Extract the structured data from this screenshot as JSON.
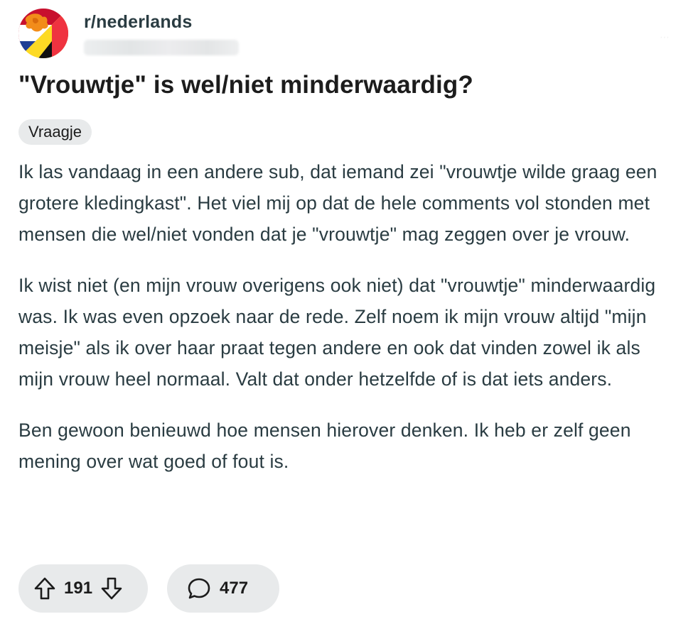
{
  "header": {
    "subreddit": "r/nederlands",
    "avatar_icon": "dutch-belgian-flag-lion-icon",
    "more_icon": "more-dots-icon"
  },
  "post": {
    "title": "\"Vrouwtje\" is wel/niet minderwaardig?",
    "flair": "Vraagje",
    "paragraphs": [
      "Ik las vandaag in een andere sub, dat iemand zei \"vrouwtje wilde graag een grotere kledingkast\". Het viel mij op dat de hele comments vol stonden met mensen die wel/niet vonden dat je \"vrouwtje\" mag zeggen over je vrouw.",
      "Ik wist niet (en mijn vrouw overigens ook niet) dat \"vrouwtje\" minderwaardig was. Ik was even opzoek naar de rede. Zelf noem ik mijn vrouw altijd \"mijn meisje\" als ik over haar praat tegen andere en ook dat vinden zowel ik als mijn vrouw heel normaal. Valt dat onder hetzelfde of is dat iets anders.",
      "Ben gewoon benieuwd hoe mensen hierover denken. Ik heb er zelf geen mening over wat goed of fout is."
    ]
  },
  "actions": {
    "upvote_icon": "upvote-arrow-icon",
    "downvote_icon": "downvote-arrow-icon",
    "score": "191",
    "comment_icon": "comment-bubble-icon",
    "comments": "477"
  },
  "colors": {
    "text": "#2a3c42",
    "title": "#1c1c1c",
    "pill_bg": "#e8eaeb",
    "background": "#ffffff"
  }
}
